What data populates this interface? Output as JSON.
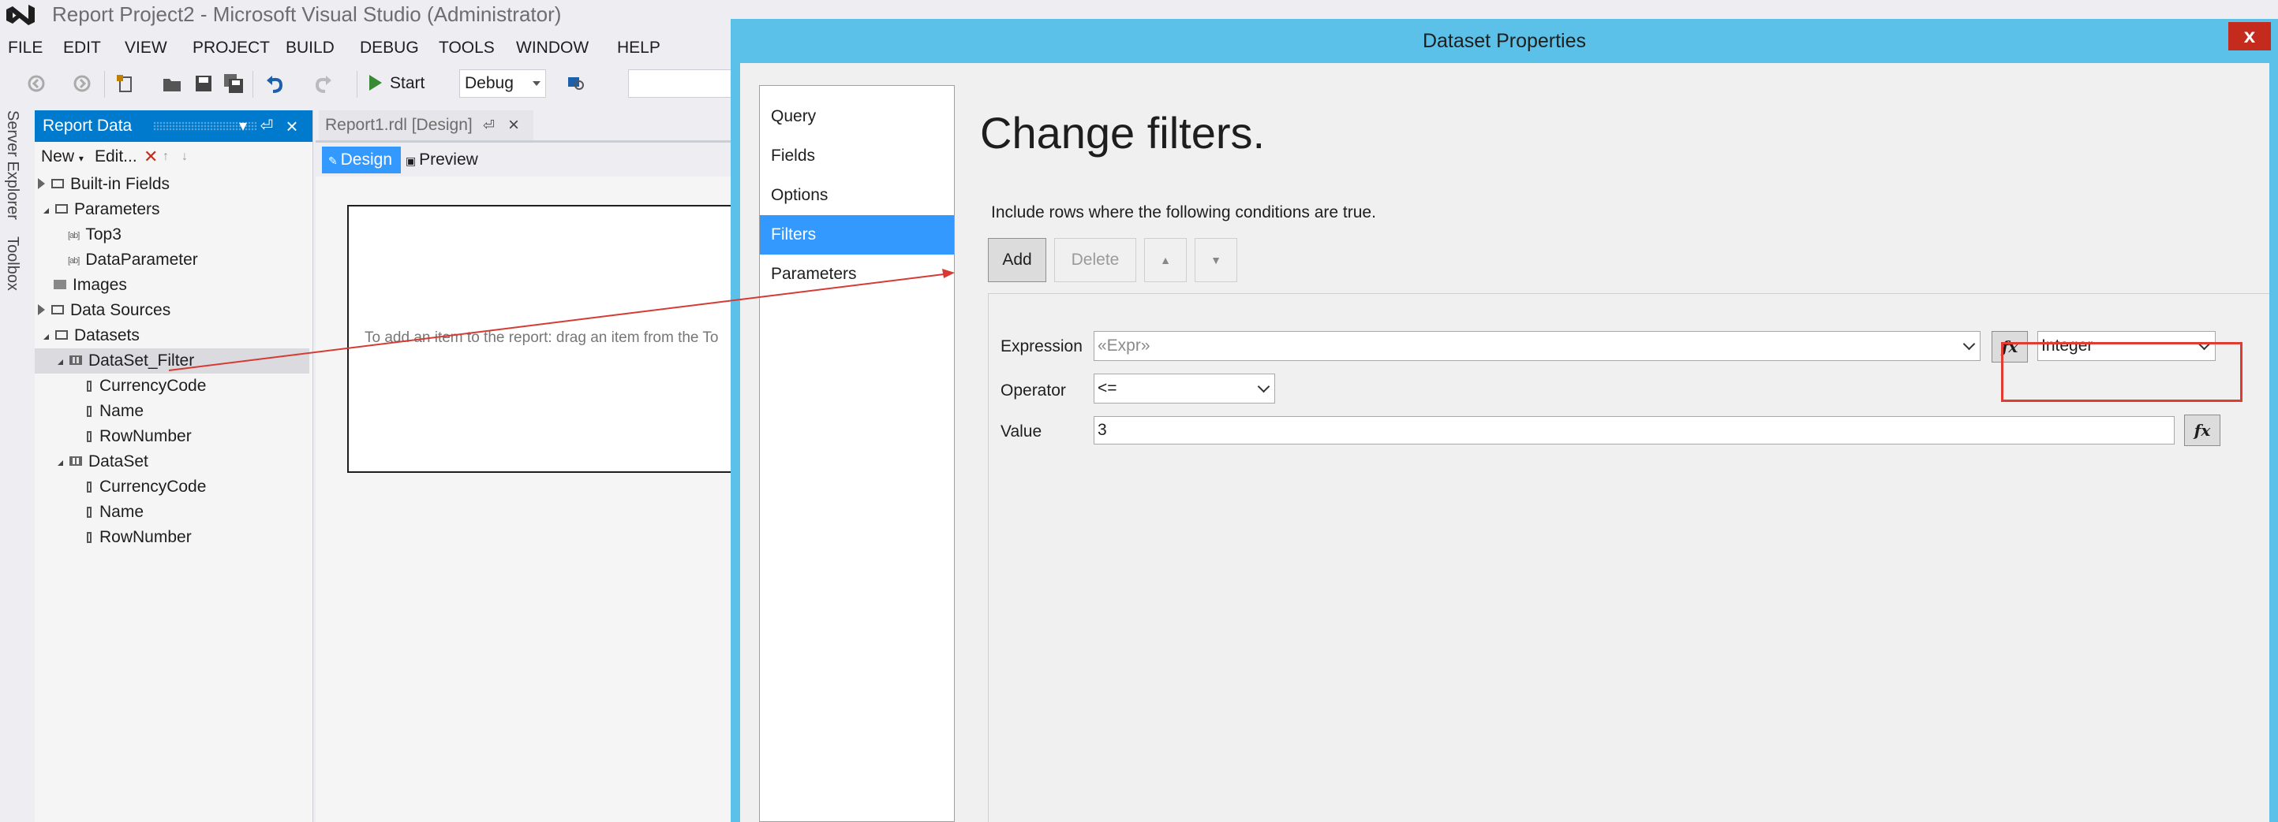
{
  "window": {
    "title": "Report Project2 - Microsoft Visual Studio (Administrator)"
  },
  "menu": [
    "FILE",
    "EDIT",
    "VIEW",
    "PROJECT",
    "BUILD",
    "DEBUG",
    "TOOLS",
    "WINDOW",
    "HELP"
  ],
  "toolbar": {
    "start_label": "Start",
    "config_value": "Debug"
  },
  "side_tabs": {
    "server_explorer": "Server Explorer",
    "toolbox": "Toolbox"
  },
  "report_data": {
    "title": "Report Data",
    "new_label": "New",
    "edit_label": "Edit...",
    "tree": {
      "builtin_fields": "Built-in Fields",
      "parameters": "Parameters",
      "param_top3": "Top3",
      "param_dataparameter": "DataParameter",
      "images": "Images",
      "data_sources": "Data Sources",
      "datasets": "Datasets",
      "dataset_filter": "DataSet_Filter",
      "df_currencycode": "CurrencyCode",
      "df_name": "Name",
      "df_rownumber": "RowNumber",
      "dataset": "DataSet",
      "ds_currencycode": "CurrencyCode",
      "ds_name": "Name",
      "ds_rownumber": "RowNumber"
    }
  },
  "document": {
    "tab_label": "Report1.rdl [Design]",
    "design_tab": "Design",
    "preview_tab": "Preview",
    "hint": "To add an item to the report: drag an item from the To"
  },
  "dialog": {
    "title": "Dataset Properties",
    "close_glyph": "x",
    "nav": [
      "Query",
      "Fields",
      "Options",
      "Filters",
      "Parameters"
    ],
    "active_nav": "Filters",
    "heading": "Change filters.",
    "description": "Include rows where the following conditions are true.",
    "buttons": {
      "add": "Add",
      "delete": "Delete"
    },
    "filter": {
      "expression_label": "Expression",
      "expression_value": "«Expr»",
      "type_value": "Integer",
      "operator_label": "Operator",
      "operator_value": "<=",
      "value_label": "Value",
      "value_value": "3"
    }
  },
  "colors": {
    "accent": "#007acc",
    "selection": "#3399ff",
    "dialog_frame": "#5cc1e8",
    "highlight": "#e03c31",
    "start_green": "#388a34"
  }
}
